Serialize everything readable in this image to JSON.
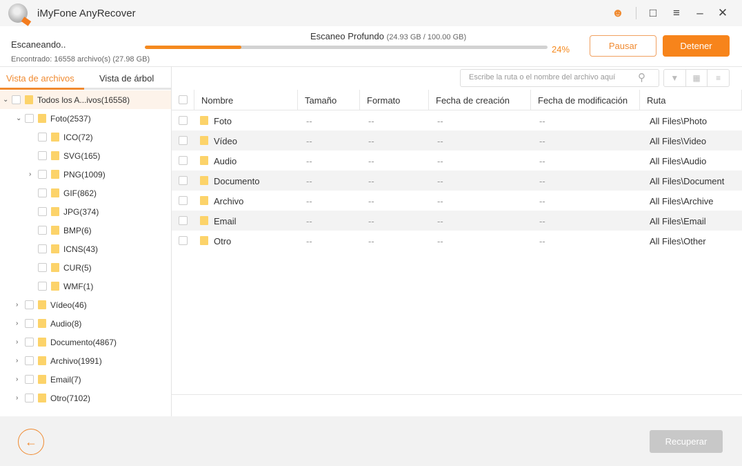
{
  "app": {
    "title": "iMyFone AnyRecover"
  },
  "titlebar": {
    "icons": [
      "user-icon",
      "feedback-icon",
      "menu-icon",
      "minimize-icon",
      "close-icon"
    ]
  },
  "scan": {
    "status": "Escaneando..",
    "found": "Encontrado: 16558 archivo(s) (27.98 GB)",
    "mode": "Escaneo Profundo",
    "size": "(24.93 GB / 100.00 GB)",
    "progress_percent": 24,
    "progress_label": "24%",
    "pause_label": "Pausar",
    "stop_label": "Detener"
  },
  "tabs": [
    {
      "label": "Vista de archivos",
      "active": true
    },
    {
      "label": "Vista de árbol",
      "active": false
    }
  ],
  "search": {
    "placeholder": "Escribe la ruta o el nombre del archivo aquí"
  },
  "tree": [
    {
      "label": "Todos los A...ivos(16558)",
      "level": 0,
      "expanded": true
    },
    {
      "label": "Foto(2537)",
      "level": 1,
      "expanded": true
    },
    {
      "label": "ICO(72)",
      "level": 2
    },
    {
      "label": "SVG(165)",
      "level": 2
    },
    {
      "label": "PNG(1009)",
      "level": 2,
      "expanded": false
    },
    {
      "label": "GIF(862)",
      "level": 2
    },
    {
      "label": "JPG(374)",
      "level": 2
    },
    {
      "label": "BMP(6)",
      "level": 2
    },
    {
      "label": "ICNS(43)",
      "level": 2
    },
    {
      "label": "CUR(5)",
      "level": 2
    },
    {
      "label": "WMF(1)",
      "level": 2
    },
    {
      "label": "Vídeo(46)",
      "level": 1,
      "expanded": false
    },
    {
      "label": "Audio(8)",
      "level": 1,
      "expanded": false
    },
    {
      "label": "Documento(4867)",
      "level": 1,
      "expanded": false
    },
    {
      "label": "Archivo(1991)",
      "level": 1,
      "expanded": false
    },
    {
      "label": "Email(7)",
      "level": 1,
      "expanded": false
    },
    {
      "label": "Otro(7102)",
      "level": 1,
      "expanded": false
    }
  ],
  "table": {
    "columns": [
      "Nombre",
      "Tamaño",
      "Formato",
      "Fecha de creación",
      "Fecha de modificación",
      "Ruta"
    ],
    "rows": [
      {
        "name": "Foto",
        "size": "--",
        "format": "--",
        "created": "--",
        "modified": "--",
        "path": "All Files\\Photo"
      },
      {
        "name": "Vídeo",
        "size": "--",
        "format": "--",
        "created": "--",
        "modified": "--",
        "path": "All Files\\Video"
      },
      {
        "name": "Audio",
        "size": "--",
        "format": "--",
        "created": "--",
        "modified": "--",
        "path": "All Files\\Audio"
      },
      {
        "name": "Documento",
        "size": "--",
        "format": "--",
        "created": "--",
        "modified": "--",
        "path": "All Files\\Document"
      },
      {
        "name": "Archivo",
        "size": "--",
        "format": "--",
        "created": "--",
        "modified": "--",
        "path": "All Files\\Archive"
      },
      {
        "name": "Email",
        "size": "--",
        "format": "--",
        "created": "--",
        "modified": "--",
        "path": "All Files\\Email"
      },
      {
        "name": "Otro",
        "size": "--",
        "format": "--",
        "created": "--",
        "modified": "--",
        "path": "All Files\\Other"
      }
    ]
  },
  "footer": {
    "recover_label": "Recuperar"
  },
  "colors": {
    "accent": "#f7841b",
    "progress_track": "#d2d2d2",
    "disabled": "#c8c8c8"
  }
}
